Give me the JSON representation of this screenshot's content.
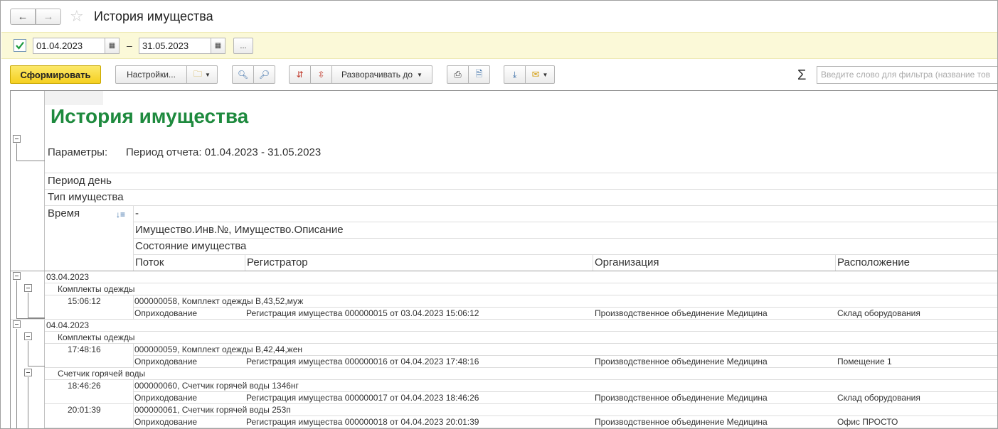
{
  "window": {
    "title": "История имущества"
  },
  "nav": {
    "back_icon": "arrow-left-icon",
    "forward_icon": "arrow-right-icon",
    "favorite_icon": "star-icon"
  },
  "period": {
    "enabled": true,
    "date_from": "01.04.2023",
    "separator": "–",
    "date_to": "31.05.2023",
    "more_label": "..."
  },
  "toolbar": {
    "generate_label": "Сформировать",
    "settings_label": "Настройки...",
    "expand_label": "Разворачивать до",
    "filter_placeholder": "Введите слово для фильтра (название тов",
    "sigma": "Σ"
  },
  "report": {
    "title": "История имущества",
    "params_label": "Параметры:",
    "params_value": "Период отчета: 01.04.2023 - 31.05.2023",
    "groupings": [
      "Период день",
      "Тип имущества",
      "Время"
    ],
    "time_dash": "-",
    "sub_header_1": "Имущество.Инв.№, Имущество.Описание",
    "sub_header_2": "Состояние имущества",
    "columns": [
      "Поток",
      "Регистратор",
      "Организация",
      "Расположение"
    ],
    "days": [
      {
        "date": "03.04.2023",
        "groups": [
          {
            "type": "Комплекты одежды",
            "records": [
              {
                "time": "15:06:12",
                "item": "000000058, Комплект одежды В,43,52,муж",
                "flow": "Оприходование",
                "registrar": "Регистрация имущества 000000015 от 03.04.2023 15:06:12",
                "org": "Производственное объединение Медицина",
                "location": "Склад оборудования"
              }
            ]
          }
        ]
      },
      {
        "date": "04.04.2023",
        "groups": [
          {
            "type": "Комплекты одежды",
            "records": [
              {
                "time": "17:48:16",
                "item": "000000059, Комплект одежды В,42,44,жен",
                "flow": "Оприходование",
                "registrar": "Регистрация имущества 000000016 от 04.04.2023 17:48:16",
                "org": "Производственное объединение Медицина",
                "location": "Помещение 1"
              }
            ]
          },
          {
            "type": "Счетчик горячей воды",
            "records": [
              {
                "time": "18:46:26",
                "item": "000000060, Счетчик горячей воды 1346нг",
                "flow": "Оприходование",
                "registrar": "Регистрация имущества 000000017 от 04.04.2023 18:46:26",
                "org": "Производственное объединение Медицина",
                "location": "Склад оборудования"
              },
              {
                "time": "20:01:39",
                "item": "000000061, Счетчик горячей воды 253п",
                "flow": "Оприходование",
                "registrar": "Регистрация имущества 000000018 от 04.04.2023 20:01:39",
                "org": "Производственное объединение Медицина",
                "location": "Офис ПРОСТО"
              }
            ]
          }
        ]
      }
    ]
  }
}
